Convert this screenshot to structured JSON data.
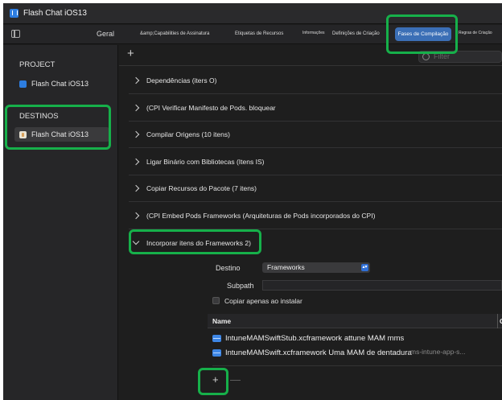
{
  "window": {
    "title": "Flash Chat iOS13"
  },
  "tabs": [
    {
      "label": "Geral"
    },
    {
      "label": "&amp;Capabilities de Assinatura"
    },
    {
      "label": "Etiquetas de Recursos"
    },
    {
      "label": "Informações"
    },
    {
      "label": "Definições de Criação"
    },
    {
      "label": "Fases de Compilação",
      "active": true
    },
    {
      "label": "Regras de Criação"
    }
  ],
  "sidebar": {
    "project_header": "PROJECT",
    "project_item": "Flash Chat iOS13",
    "targets_header": "DESTINOS",
    "target_item": "Flash Chat iOS13"
  },
  "toolbar": {
    "add_label": "+",
    "filter_placeholder": "Filter"
  },
  "phases": [
    {
      "label": "Dependências (iters O)",
      "expanded": false
    },
    {
      "label": "(CPI Verificar Manifesto de Pods. bloquear",
      "expanded": false
    },
    {
      "label": "Compilar Origens (10 itens)",
      "expanded": false
    },
    {
      "label": "Ligar Binário com Bibliotecas (Itens IS)",
      "expanded": false
    },
    {
      "label": "Copiar Recursos do Pacote (7 itens)",
      "expanded": false
    },
    {
      "label": "(CPI Embed Pods Frameworks (Arquiteturas de Pods incorporados do CPI)",
      "expanded": false
    },
    {
      "label": "Incorporar itens do Frameworks 2)",
      "expanded": true
    }
  ],
  "embed": {
    "destination_label": "Destino",
    "destination_value": "Frameworks",
    "subpath_label": "Subpath",
    "copy_only_label": "Copiar apenas ao instalar",
    "table_header_name": "Name",
    "table_header_c": "C",
    "rows": [
      "IntuneMAMSwiftStub.xcframework attune MAM mms",
      "IntuneMAMSwift.xcframework Uma MAM de dentadura"
    ],
    "row_extra": "ms-intune-app-s...",
    "add_item_label": "+",
    "remove_item_label": "—"
  },
  "colors": {
    "highlight": "#16b04a",
    "accent": "#3b6fb6",
    "background": "#1e1e1e"
  }
}
